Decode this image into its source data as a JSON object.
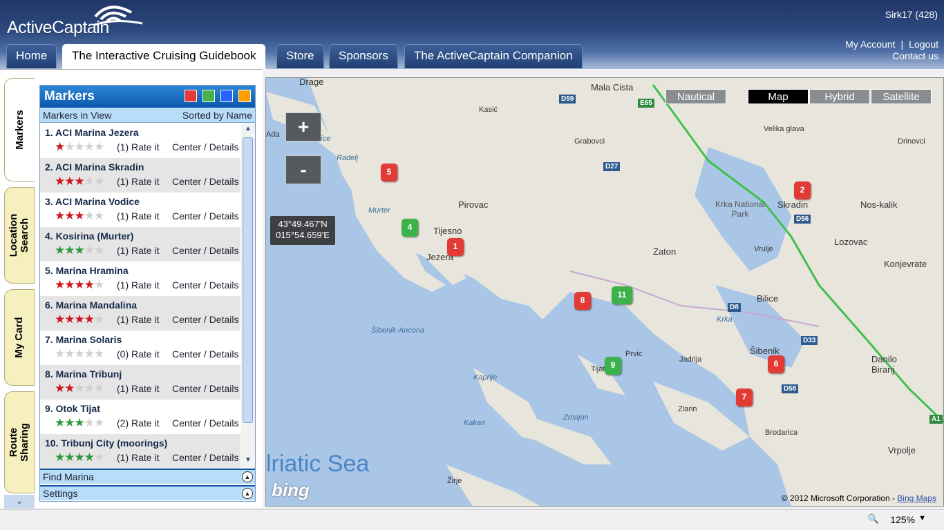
{
  "header": {
    "logo_text": "ActiveCaptain",
    "user": "Sirk17 (428)",
    "my_account": "My Account",
    "separator": "|",
    "logout": "Logout",
    "contact": "Contact us"
  },
  "tabs": [
    {
      "label": "Home"
    },
    {
      "label": "The Interactive Cruising Guidebook"
    },
    {
      "label": "Store"
    },
    {
      "label": "Sponsors"
    },
    {
      "label": "The ActiveCaptain Companion"
    }
  ],
  "vtabs": [
    {
      "label": "Markers"
    },
    {
      "label": "Location Search"
    },
    {
      "label": "My Card"
    },
    {
      "label": "Route Sharing"
    }
  ],
  "markers_panel": {
    "title": "Markers",
    "colors": [
      "#e53935",
      "#43b34a",
      "#2962ff",
      "#ffa000"
    ],
    "in_view": "Markers in View",
    "sorted": "Sorted by Name",
    "items": [
      {
        "name": "1. ACI Marina Jezera",
        "stars": 1,
        "star_color": "#d0161c",
        "rating": "(1) Rate it",
        "link": "Center / Details"
      },
      {
        "name": "2. ACI Marina Skradin",
        "stars": 3,
        "star_color": "#d0161c",
        "rating": "(1) Rate it",
        "link": "Center / Details"
      },
      {
        "name": "3. ACI Marina Vodice",
        "stars": 3,
        "star_color": "#d0161c",
        "rating": "(1) Rate it",
        "link": "Center / Details"
      },
      {
        "name": "4. Kosirina (Murter)",
        "stars": 3,
        "star_color": "#2d9a3c",
        "rating": "(1) Rate it",
        "link": "Center / Details"
      },
      {
        "name": "5. Marina Hramina",
        "stars": 4,
        "star_color": "#d0161c",
        "rating": "(1) Rate it",
        "link": "Center / Details"
      },
      {
        "name": "6. Marina Mandalina",
        "stars": 4,
        "star_color": "#d0161c",
        "rating": "(1) Rate it",
        "link": "Center / Details"
      },
      {
        "name": "7. Marina Solaris",
        "stars": 0,
        "star_color": "#d0161c",
        "rating": "(0) Rate it",
        "link": "Center / Details"
      },
      {
        "name": "8. Marina Tribunj",
        "stars": 2,
        "star_color": "#d0161c",
        "rating": "(1) Rate it",
        "link": "Center / Details"
      },
      {
        "name": "9. Otok Tijat",
        "stars": 3,
        "star_color": "#2d9a3c",
        "rating": "(2) Rate it",
        "link": "Center / Details"
      },
      {
        "name": "10. Tribunj City (moorings)",
        "stars": 4,
        "star_color": "#2d9a3c",
        "rating": "(1) Rate it",
        "link": "Center / Details"
      }
    ],
    "find_marina": "Find Marina",
    "settings": "Settings"
  },
  "map": {
    "zoom_in": "+",
    "zoom_out": "-",
    "coords_lat": "43°49.467'N",
    "coords_lon": "015°54.659'E",
    "types": [
      {
        "label": "Nautical"
      },
      {
        "label": "Map"
      },
      {
        "label": "Hybrid"
      },
      {
        "label": "Satellite"
      }
    ],
    "active_type": "Map",
    "sea_label": "lriatic Sea",
    "bing": "bing",
    "copyright": "© 2012 Microsoft Corporation - ",
    "copyright_link": "Bing Maps",
    "places": [
      "Mala Cista",
      "Kasić",
      "Grabovci",
      "Velika glava",
      "Drinovci",
      "Radelj",
      "Murter",
      "Tijesno",
      "Jezera",
      "Pirovac",
      "Krka National Park",
      "Skradin",
      "Nos-kalik",
      "Lozovac",
      "Zaton",
      "Vrulje",
      "Konjevrate",
      "Bilice",
      "Krka",
      "Šibenik",
      "Danilo Biranj",
      "Jadrija",
      "Prvic",
      "Tijat",
      "Kaprije",
      "Kakan",
      "Zmajan",
      "Zlarin",
      "Brodarica",
      "Vrpolje",
      "Žirje",
      "Šibenik-Ancona",
      "Drage",
      "Vodice",
      "Ada"
    ],
    "roads": [
      "D59",
      "E65",
      "D27",
      "D56",
      "D8",
      "D33",
      "D58",
      "A1"
    ],
    "pins": [
      {
        "label": "1",
        "color": "red"
      },
      {
        "label": "2",
        "color": "red"
      },
      {
        "label": "4",
        "color": "green"
      },
      {
        "label": "5",
        "color": "red"
      },
      {
        "label": "6",
        "color": "red"
      },
      {
        "label": "7",
        "color": "red"
      },
      {
        "label": "8",
        "color": "red"
      },
      {
        "label": "9",
        "color": "green"
      },
      {
        "label": "11",
        "color": "green"
      }
    ]
  },
  "status": {
    "zoom": "125%"
  }
}
